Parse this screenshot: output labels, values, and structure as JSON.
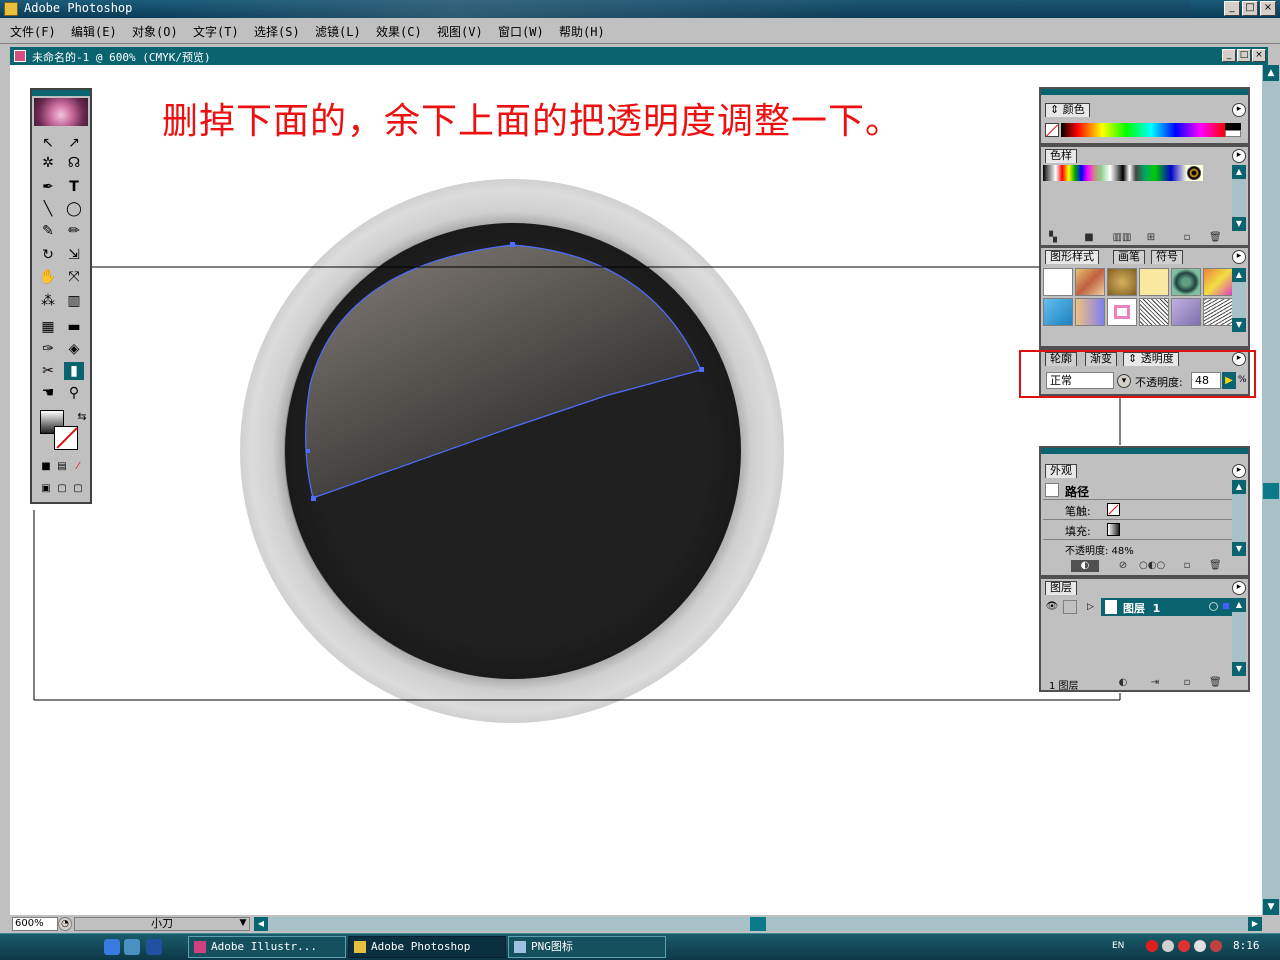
{
  "app": {
    "title": "Adobe Photoshop",
    "window_buttons": [
      "_",
      "□",
      "×"
    ]
  },
  "menu": {
    "items": [
      "文件(F)",
      "编辑(E)",
      "对象(O)",
      "文字(T)",
      "选择(S)",
      "滤镜(L)",
      "效果(C)",
      "视图(V)",
      "窗口(W)",
      "帮助(H)"
    ]
  },
  "document": {
    "title": "未命名的-1 @ 600% (CMYK/预览)",
    "annotation": "删掉下面的，余下上面的把透明度调整一下。"
  },
  "panels": {
    "color": {
      "tab": "颜色"
    },
    "swatches": {
      "tab": "色样"
    },
    "styles": {
      "tabs": [
        "图形样式",
        "画笔",
        "符号"
      ]
    },
    "transparency": {
      "tabs": [
        "轮廓",
        "渐变",
        "透明度"
      ],
      "blend_mode": "正常",
      "opacity_label": "不透明度:",
      "opacity_value": "48",
      "opacity_unit": "%"
    },
    "appearance": {
      "tab": "外观",
      "object": "路径",
      "stroke_label": "笔触:",
      "fill_label": "填充:",
      "opacity_line": "不透明度: 48%"
    },
    "layers": {
      "tab": "图层",
      "layer_name": "图层  1",
      "footer": "1 图层"
    }
  },
  "status": {
    "zoom": "600%",
    "tool": "小刀"
  },
  "taskbar": {
    "tasks": [
      "Adobe Illustr...",
      "Adobe Photoshop",
      "PNG图标"
    ],
    "lang": "EN",
    "clock": "8:16"
  },
  "colors": {
    "annotation": "#ee1010",
    "highlight_box": "#e01010",
    "selection_path": "#4f6cff",
    "teal": "#0a6470"
  }
}
